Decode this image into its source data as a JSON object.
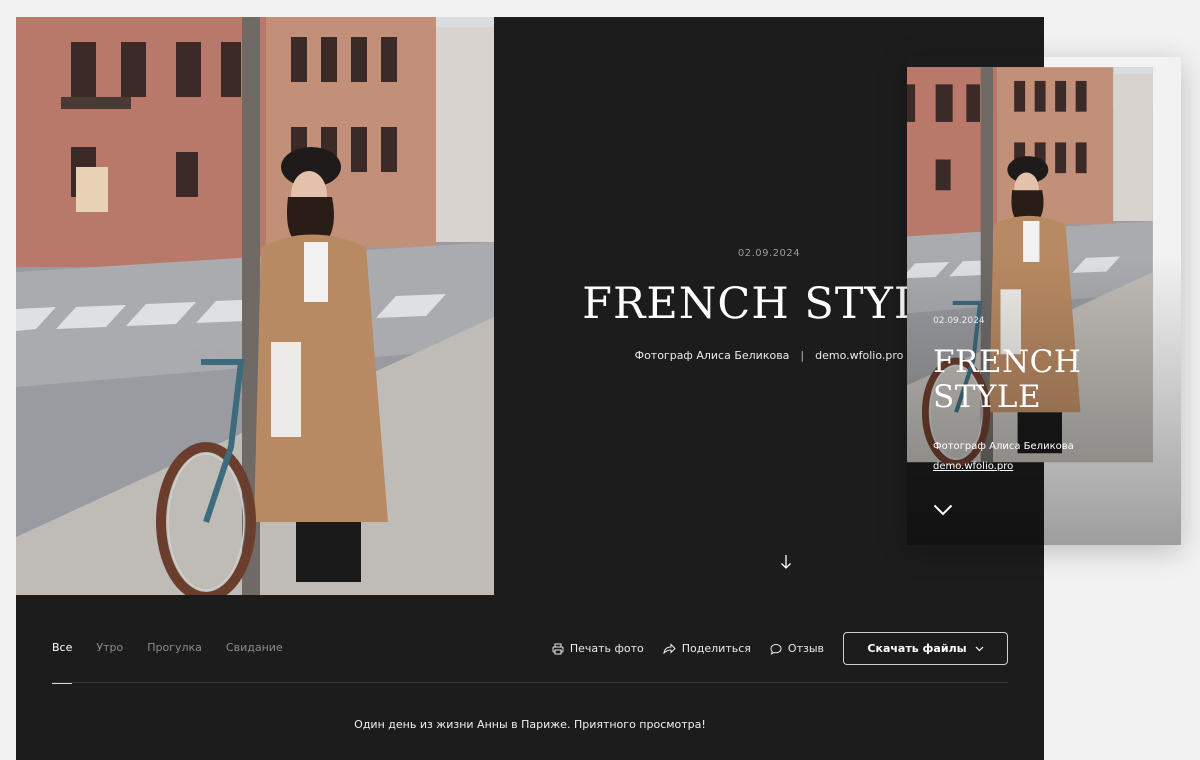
{
  "gallery": {
    "date": "02.09.2024",
    "title": "FRENCH STYLE",
    "photographer": "Фотограф Алиса Беликова",
    "separator": "|",
    "website": "demo.wfolio.pro",
    "description": "Один день из жизни Анны в Париже. Приятного просмотра!"
  },
  "tabs": [
    {
      "label": "Все",
      "active": true
    },
    {
      "label": "Утро",
      "active": false
    },
    {
      "label": "Прогулка",
      "active": false
    },
    {
      "label": "Свидание",
      "active": false
    }
  ],
  "actions": {
    "print": {
      "label": "Печать фото",
      "icon": "printer-icon"
    },
    "share": {
      "label": "Поделиться",
      "icon": "share-icon"
    },
    "review": {
      "label": "Отзыв",
      "icon": "chat-bubble-icon"
    },
    "download": {
      "label": "Скачать файлы",
      "icon": "chevron-down-icon"
    }
  },
  "mobile": {
    "date": "02.09.2024",
    "title": "FRENCH STYLE",
    "photographer": "Фотограф Алиса Беликова",
    "website": "demo.wfolio.pro"
  },
  "colors": {
    "background": "#1c1c1c",
    "page": "#f2f2f2",
    "text": "#ffffff",
    "muted": "#8b8b8b"
  }
}
